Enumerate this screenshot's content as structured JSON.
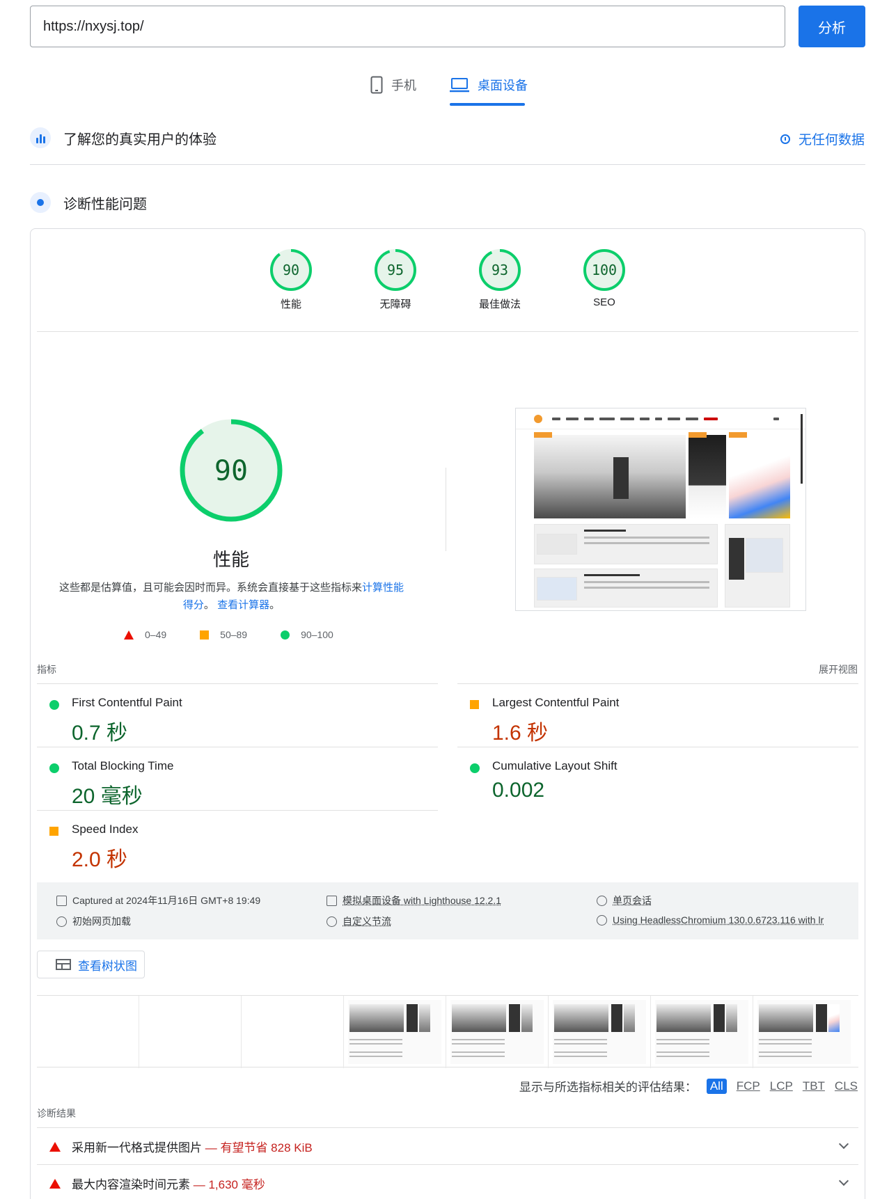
{
  "url": {
    "value": "https://nxysj.top/",
    "button": "分析"
  },
  "device_tabs": [
    {
      "label": "手机",
      "icon": "phone-icon",
      "selected": false
    },
    {
      "label": "桌面设备",
      "icon": "laptop-icon",
      "selected": true
    }
  ],
  "crux": {
    "title": "了解您的真实用户的体验",
    "no_data": "无任何数据"
  },
  "diagnose": {
    "title": "诊断性能问题"
  },
  "categories": [
    {
      "score": 90,
      "label": "性能"
    },
    {
      "score": 95,
      "label": "无障碍"
    },
    {
      "score": 93,
      "label": "最佳做法"
    },
    {
      "score": 100,
      "label": "SEO"
    }
  ],
  "performance": {
    "score": 90,
    "title": "性能",
    "note_prefix": "这些都是估算值，且可能会因时而异。系统会直接基于这些指标来",
    "note_link1": "计算性能得分",
    "note_mid": "。",
    "note_link2": "查看计算器",
    "note_suffix": "。"
  },
  "legend": [
    {
      "range": "0–49",
      "color": "#eb0f00"
    },
    {
      "range": "50–89",
      "color": "#ffa400"
    },
    {
      "range": "90–100",
      "color": "#0cce6b"
    }
  ],
  "metrics_header": {
    "label": "指标",
    "expand": "展开视图"
  },
  "metrics": [
    {
      "name": "First Contentful Paint",
      "value": "0.7 秒",
      "status": "good"
    },
    {
      "name": "Largest Contentful Paint",
      "value": "1.6 秒",
      "status": "average"
    },
    {
      "name": "Total Blocking Time",
      "value": "20 毫秒",
      "status": "good"
    },
    {
      "name": "Cumulative Layout Shift",
      "value": "0.002",
      "status": "good"
    },
    {
      "name": "Speed Index",
      "value": "2.0 秒",
      "status": "average"
    }
  ],
  "runtime": {
    "captured": "Captured at 2024年11月16日 GMT+8 19:49",
    "device": "模拟桌面设备 with Lighthouse 12.2.1",
    "session": "单页会话",
    "load": "初始网页加载",
    "throttling": "自定义节流",
    "browser": "Using HeadlessChromium 130.0.6723.116 with lr"
  },
  "tree_button": "查看树状图",
  "filter": {
    "label": "显示与所选指标相关的评估结果：",
    "options": [
      "All",
      "FCP",
      "LCP",
      "TBT",
      "CLS"
    ]
  },
  "diagnostics": {
    "label": "诊断结果",
    "items": [
      {
        "title": "采用新一代格式提供图片",
        "saving": "— 有望节省 828 KiB"
      },
      {
        "title": "最大内容渲染时间元素",
        "saving": "— 1,630 毫秒"
      }
    ]
  },
  "colors": {
    "accent": "#1a73e8",
    "good": "#0cce6b",
    "average": "#ffa400",
    "fail": "#eb0f00"
  }
}
